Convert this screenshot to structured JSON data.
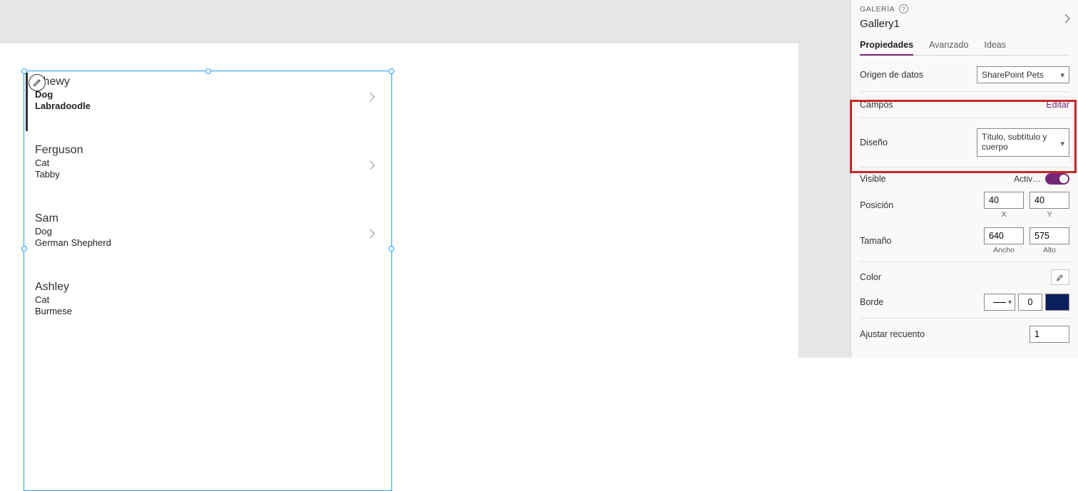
{
  "gallery": {
    "items": [
      {
        "title": "Chewy",
        "subtitle": "Dog",
        "body": "Labradoodle",
        "selected": true
      },
      {
        "title": "Ferguson",
        "subtitle": "Cat",
        "body": "Tabby",
        "selected": false
      },
      {
        "title": "Sam",
        "subtitle": "Dog",
        "body": "German Shepherd",
        "selected": false
      },
      {
        "title": "Ashley",
        "subtitle": "Cat",
        "body": "Burmese",
        "selected": false
      }
    ]
  },
  "panel": {
    "section": "GALERÍA",
    "control_name": "Gallery1",
    "tabs": {
      "props": "Propiedades",
      "advanced": "Avanzado",
      "ideas": "Ideas"
    },
    "rows": {
      "datasource_label": "Origen de datos",
      "datasource_value": "SharePoint Pets",
      "fields_label": "Campos",
      "fields_action": "Editar",
      "layout_label": "Diseño",
      "layout_value": "Título, subtítulo y cuerpo",
      "visible_label": "Visible",
      "visible_value": "Activ…",
      "position_label": "Posición",
      "position_x": "40",
      "position_y": "40",
      "position_x_sub": "X",
      "position_y_sub": "Y",
      "size_label": "Tamaño",
      "size_w": "640",
      "size_h": "575",
      "size_w_sub": "Ancho",
      "size_h_sub": "Alto",
      "color_label": "Color",
      "border_label": "Borde",
      "border_width": "0",
      "wrap_label": "Ajustar recuento",
      "wrap_value": "1"
    }
  }
}
